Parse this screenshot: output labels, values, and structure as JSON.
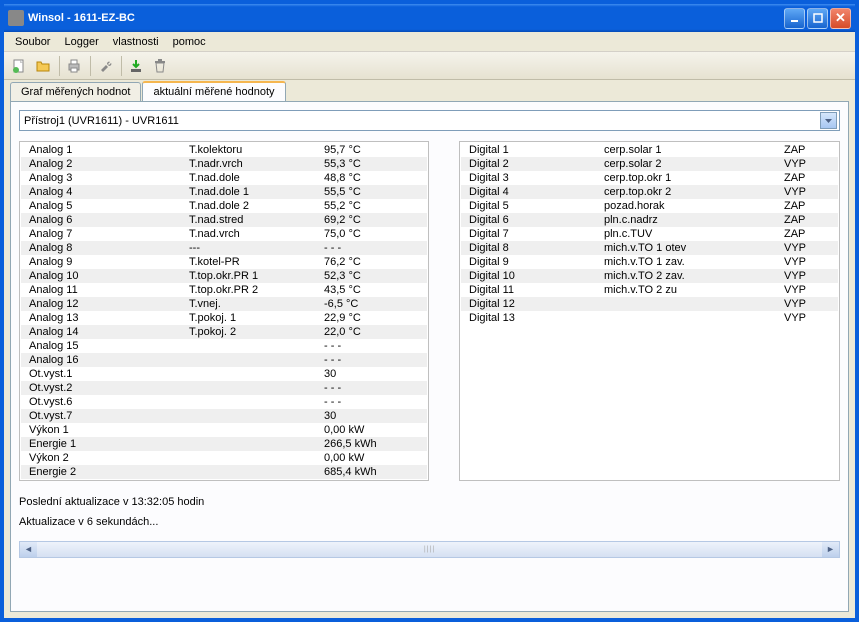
{
  "title": "Winsol - 1611-EZ-BC",
  "menu": {
    "soubor": "Soubor",
    "logger": "Logger",
    "vlastnosti": "vlastnosti",
    "pomoc": "pomoc"
  },
  "tabs": {
    "graf": "Graf měřených hodnot",
    "aktualni": "aktuální měřené hodnoty"
  },
  "dropdown": "Přístroj1 (UVR1611) - UVR1611",
  "analog": [
    {
      "name": "Analog 1",
      "label": "T.kolektoru",
      "value": "95,7 °C"
    },
    {
      "name": "Analog 2",
      "label": "T.nadr.vrch",
      "value": "55,3 °C"
    },
    {
      "name": "Analog 3",
      "label": "T.nad.dole",
      "value": "48,8 °C"
    },
    {
      "name": "Analog 4",
      "label": "T.nad.dole 1",
      "value": "55,5 °C"
    },
    {
      "name": "Analog 5",
      "label": "T.nad.dole 2",
      "value": "55,2 °C"
    },
    {
      "name": "Analog 6",
      "label": "T.nad.stred",
      "value": "69,2 °C"
    },
    {
      "name": "Analog 7",
      "label": "T.nad.vrch",
      "value": "75,0 °C"
    },
    {
      "name": "Analog 8",
      "label": "---",
      "value": "- - -"
    },
    {
      "name": "Analog 9",
      "label": "T.kotel-PR",
      "value": "76,2 °C"
    },
    {
      "name": "Analog 10",
      "label": "T.top.okr.PR 1",
      "value": "52,3 °C"
    },
    {
      "name": "Analog 11",
      "label": "T.top.okr.PR 2",
      "value": "43,5 °C"
    },
    {
      "name": "Analog 12",
      "label": "T.vnej.",
      "value": "-6,5 °C"
    },
    {
      "name": "Analog 13",
      "label": "T.pokoj. 1",
      "value": "22,9 °C"
    },
    {
      "name": "Analog 14",
      "label": "T.pokoj. 2",
      "value": "22,0 °C"
    },
    {
      "name": "Analog 15",
      "label": "",
      "value": "- - -"
    },
    {
      "name": "Analog 16",
      "label": "",
      "value": "- - -"
    },
    {
      "name": "Ot.vyst.1",
      "label": "",
      "value": "30"
    },
    {
      "name": "Ot.vyst.2",
      "label": "",
      "value": "- - -"
    },
    {
      "name": "Ot.vyst.6",
      "label": "",
      "value": "- - -"
    },
    {
      "name": "Ot.vyst.7",
      "label": "",
      "value": "30"
    },
    {
      "name": "Výkon 1",
      "label": "",
      "value": "0,00 kW"
    },
    {
      "name": "Energie 1",
      "label": "",
      "value": "266,5 kWh"
    },
    {
      "name": "Výkon 2",
      "label": "",
      "value": "0,00 kW"
    },
    {
      "name": "Energie 2",
      "label": "",
      "value": "685,4 kWh"
    }
  ],
  "digital": [
    {
      "name": "Digital 1",
      "label": "cerp.solar 1",
      "value": "ZAP"
    },
    {
      "name": "Digital 2",
      "label": "cerp.solar 2",
      "value": "VYP"
    },
    {
      "name": "Digital 3",
      "label": "cerp.top.okr 1",
      "value": "ZAP"
    },
    {
      "name": "Digital 4",
      "label": "cerp.top.okr 2",
      "value": "VYP"
    },
    {
      "name": "Digital 5",
      "label": "pozad.horak",
      "value": "ZAP"
    },
    {
      "name": "Digital 6",
      "label": "pln.c.nadrz",
      "value": "ZAP"
    },
    {
      "name": "Digital 7",
      "label": "pln.c.TUV",
      "value": "ZAP"
    },
    {
      "name": "Digital 8",
      "label": "mich.v.TO 1 otev",
      "value": "VYP"
    },
    {
      "name": "Digital 9",
      "label": "mich.v.TO 1 zav.",
      "value": "VYP"
    },
    {
      "name": "Digital 10",
      "label": "mich.v.TO 2 zav.",
      "value": "VYP"
    },
    {
      "name": "Digital 11",
      "label": "mich.v.TO 2 zu",
      "value": "VYP"
    },
    {
      "name": "Digital 12",
      "label": "",
      "value": "VYP"
    },
    {
      "name": "Digital 13",
      "label": "",
      "value": "VYP"
    }
  ],
  "status1": "Poslední aktualizace v 13:32:05 hodin",
  "status2": "Aktualizace v 6 sekundách..."
}
